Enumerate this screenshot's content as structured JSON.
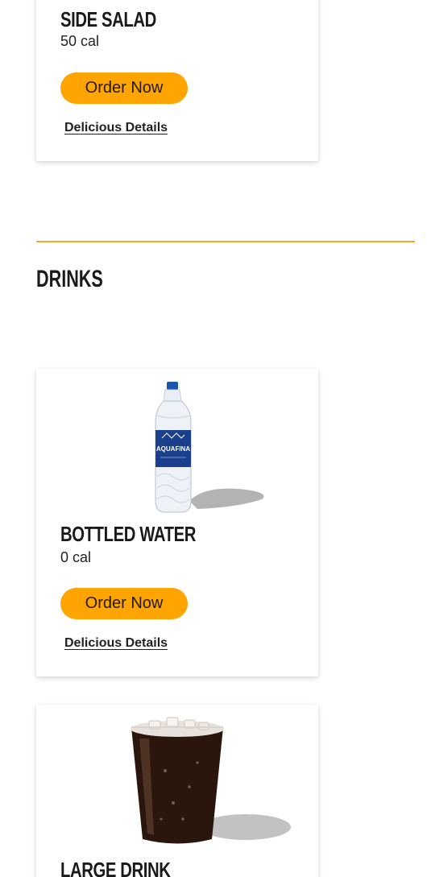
{
  "menu": {
    "actions": {
      "order_label": "Order Now",
      "details_label": "Delicious Details"
    },
    "items_above": [
      {
        "name": "Side Salad",
        "calories": "50 cal"
      }
    ],
    "section": {
      "title": "Drinks",
      "accent_color": "#f5a623",
      "items": [
        {
          "name": "Bottled Water",
          "calories": "0 cal",
          "image": "water-bottle",
          "bottle_label": "AQUAFINA"
        },
        {
          "name": "Large Drink",
          "calories": "",
          "image": "soda-cup"
        }
      ]
    }
  },
  "colors": {
    "order_button": "#ffa400",
    "divider": "#f5a623"
  }
}
